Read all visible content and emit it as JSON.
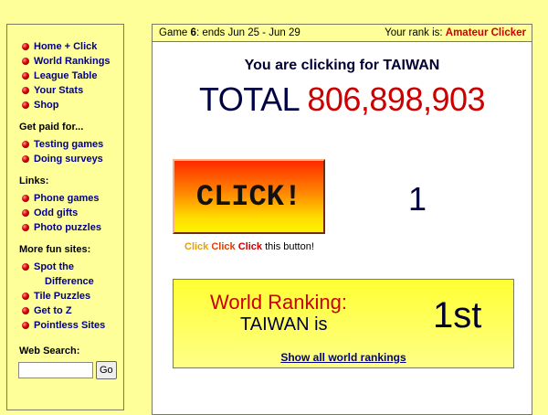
{
  "sidebar": {
    "main_links": [
      "Home + Click",
      "World Rankings",
      "League Table",
      "Your Stats",
      "Shop"
    ],
    "paid": {
      "heading": "Get paid for...",
      "items": [
        "Testing games",
        "Doing surveys"
      ]
    },
    "links": {
      "heading": "Links:",
      "items": [
        "Phone games",
        "Odd gifts",
        "Photo puzzles"
      ]
    },
    "fun": {
      "heading": "More fun sites:",
      "items": [
        {
          "line1": "Spot the",
          "line2": "Difference"
        },
        "Tile Puzzles",
        "Get to Z",
        "Pointless Sites"
      ]
    },
    "search": {
      "label": "Web Search:",
      "value": "",
      "go": "Go"
    }
  },
  "game_bar": {
    "game_label": "Game",
    "game_number": "6",
    "ends": ": ends Jun 25 - Jun 29",
    "rank_label": "Your rank is:",
    "rank_value": "Amateur Clicker"
  },
  "main": {
    "clicking_for": "You are clicking for TAIWAN",
    "total_label": "TOTAL",
    "total_value": "806,898,903",
    "click_button": "CLICK!",
    "click_count": "1",
    "hint": {
      "w1": "Click",
      "w2": "Click",
      "w3": "Click",
      "rest": "this button!"
    },
    "ranking": {
      "label": "World Ranking:",
      "country_line": "TAIWAN is",
      "position": "1st",
      "link": "Show all world rankings"
    }
  },
  "colors": {
    "page_bg": "#ffff99",
    "accent_red": "#cc0000",
    "link_blue": "#000088"
  }
}
